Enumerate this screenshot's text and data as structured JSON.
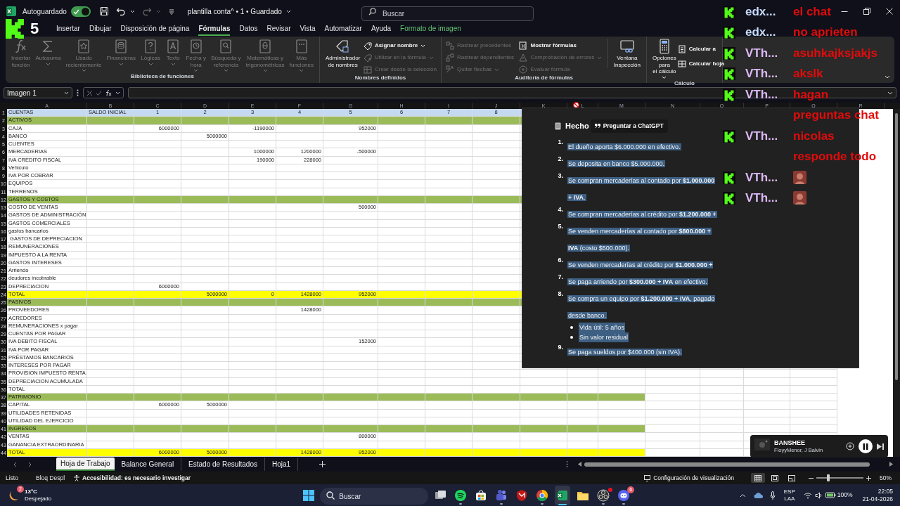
{
  "title_bar": {
    "autosave_label": "Autoguardado",
    "autosave_on": true,
    "document_title": "plantilla conta^ • 1 • Guardado",
    "search_placeholder": "Buscar"
  },
  "stream_overlay": {
    "count": "5"
  },
  "menu_tabs": [
    {
      "label": "Insertar",
      "selected": false,
      "kind": "normal"
    },
    {
      "label": "Dibujar",
      "selected": false,
      "kind": "normal"
    },
    {
      "label": "Disposición de página",
      "selected": false,
      "kind": "normal"
    },
    {
      "label": "Fórmulas",
      "selected": true,
      "kind": "normal"
    },
    {
      "label": "Datos",
      "selected": false,
      "kind": "normal"
    },
    {
      "label": "Revisar",
      "selected": false,
      "kind": "normal"
    },
    {
      "label": "Vista",
      "selected": false,
      "kind": "normal"
    },
    {
      "label": "Automatizar",
      "selected": false,
      "kind": "normal"
    },
    {
      "label": "Ayuda",
      "selected": false,
      "kind": "normal"
    },
    {
      "label": "Formato de imagen",
      "selected": false,
      "kind": "contextual"
    }
  ],
  "ribbon": {
    "groups": [
      {
        "label": "Biblioteca de funciones",
        "items": [
          {
            "kind": "large",
            "label": "Insertar\nfunción",
            "disabled": true
          },
          {
            "kind": "large",
            "label": "Autosuma",
            "disabled": true,
            "dropdown": true
          },
          {
            "kind": "large",
            "label": "Usado\nrecientemente",
            "disabled": true,
            "dropdown": true
          },
          {
            "kind": "large",
            "label": "Financieras",
            "disabled": true,
            "dropdown": true
          },
          {
            "kind": "large",
            "label": "Lógicas",
            "disabled": true,
            "dropdown": true
          },
          {
            "kind": "large",
            "label": "Texto",
            "disabled": true,
            "dropdown": true
          },
          {
            "kind": "large",
            "label": "Fecha y\nhora",
            "disabled": true,
            "dropdown": true
          },
          {
            "kind": "large",
            "label": "Búsqueda y\nreferencia",
            "disabled": true,
            "dropdown": true
          },
          {
            "kind": "large",
            "label": "Matemáticas y\ntrigonométricas",
            "disabled": true,
            "dropdown": true
          },
          {
            "kind": "large",
            "label": "Más\nfunciones",
            "disabled": true,
            "dropdown": true
          }
        ]
      },
      {
        "label": "Nombres definidos",
        "items": [
          {
            "kind": "large",
            "label": "Administrador\nde nombres",
            "disabled": false
          },
          {
            "kind": "stack",
            "items": [
              {
                "label": "Asignar nombre",
                "disabled": false,
                "dropdown": true
              },
              {
                "label": "Utilizar en la fórmula",
                "disabled": true,
                "dropdown": true
              },
              {
                "label": "Crear desde la selección",
                "disabled": true
              }
            ]
          }
        ]
      },
      {
        "label": "Auditoría de fórmulas",
        "items": [
          {
            "kind": "stack",
            "items": [
              {
                "label": "Rastrear precedentes",
                "disabled": true
              },
              {
                "label": "Rastrear dependientes",
                "disabled": true
              },
              {
                "label": "Quitar flechas",
                "disabled": true,
                "dropdown": true
              }
            ]
          },
          {
            "kind": "stack",
            "items": [
              {
                "label": "Mostrar fórmulas",
                "disabled": false
              },
              {
                "label": "Comprobación de errores",
                "disabled": true,
                "dropdown": true
              },
              {
                "label": "Evaluar fórmula",
                "disabled": true
              }
            ]
          },
          {
            "kind": "large",
            "label": "Ventana\nInspección",
            "disabled": false
          }
        ]
      },
      {
        "label": "Cálculo",
        "items": [
          {
            "kind": "large",
            "label": "Opciones para\nel cálculo",
            "disabled": false,
            "dropdown": true
          },
          {
            "kind": "stack",
            "items": [
              {
                "label": "Calcular a",
                "disabled": false
              },
              {
                "label": "Calcular hoja",
                "disabled": false
              }
            ]
          }
        ]
      }
    ]
  },
  "formula_bar": {
    "name_box": "Imagen 1"
  },
  "sheet": {
    "column_letters": [
      "A",
      "B",
      "C",
      "D",
      "E",
      "F",
      "G",
      "H",
      "I",
      "J",
      "K",
      "L",
      "M",
      "N",
      "O",
      "P",
      "Q",
      "R"
    ],
    "rows": [
      {
        "num": "1",
        "kind": "header",
        "cells": {
          "A": "CUENTAS",
          "B": "SALDO INICIAL",
          "C": "1",
          "D": "2",
          "E": "3",
          "F": "4",
          "G": "5",
          "H": "6",
          "I": "7",
          "J": "8"
        }
      },
      {
        "num": "2",
        "kind": "section",
        "cells": {
          "A": "ACTIVOS"
        }
      },
      {
        "num": "3",
        "kind": "data",
        "cells": {
          "A": "CAJA",
          "C": "6000000",
          "E": "-1190000",
          "G": "952000"
        }
      },
      {
        "num": "4",
        "kind": "data",
        "cells": {
          "A": "BANCO",
          "D": "5000000"
        }
      },
      {
        "num": "5",
        "kind": "data",
        "cells": {
          "A": "CLIENTES"
        }
      },
      {
        "num": "6",
        "kind": "data",
        "cells": {
          "A": "MERCADERIAS",
          "E": "1000000",
          "F": "1200000",
          "G": "-500000"
        }
      },
      {
        "num": "7",
        "kind": "data",
        "cells": {
          "A": "IVA CREDITO FISCAL",
          "E": "190000",
          "F": "228000"
        }
      },
      {
        "num": "8",
        "kind": "data",
        "cells": {
          "A": "Vehiculo"
        }
      },
      {
        "num": "9",
        "kind": "data",
        "cells": {
          "A": "IVA POR COBRAR"
        }
      },
      {
        "num": "10",
        "kind": "data",
        "cells": {
          "A": "EQUIPOS"
        }
      },
      {
        "num": "11",
        "kind": "data",
        "cells": {
          "A": "TERRENOS"
        }
      },
      {
        "num": "12",
        "kind": "section",
        "cells": {
          "A": "GASTOS Y COSTOS"
        }
      },
      {
        "num": "13",
        "kind": "data",
        "cells": {
          "A": "COSTO DE VENTAS",
          "G": "500000"
        }
      },
      {
        "num": "14",
        "kind": "data",
        "cells": {
          "A": "GASTOS DE ADMINISTRACIÓN"
        }
      },
      {
        "num": "15",
        "kind": "data",
        "cells": {
          "A": "GASTOS COMERCIALES"
        }
      },
      {
        "num": "16",
        "kind": "data",
        "cells": {
          "A": "gastos bancarios"
        }
      },
      {
        "num": "17",
        "kind": "data",
        "cells": {
          "A": " GASTOS DE DEPRECIACION"
        }
      },
      {
        "num": "18",
        "kind": "data",
        "cells": {
          "A": "REMUNERACIONES"
        }
      },
      {
        "num": "19",
        "kind": "data",
        "cells": {
          "A": "IMPUESTO A LA RENTA"
        }
      },
      {
        "num": "20",
        "kind": "data",
        "cells": {
          "A": "GASTOS INTERESES"
        }
      },
      {
        "num": "21",
        "kind": "data",
        "cells": {
          "A": "Arriendo"
        }
      },
      {
        "num": "22",
        "kind": "data",
        "cells": {
          "A": "deudores incobrable"
        }
      },
      {
        "num": "23",
        "kind": "data",
        "cells": {
          "A": "DEPRECIACION",
          "C": "6000000"
        }
      },
      {
        "num": "24",
        "kind": "total",
        "cells": {
          "A": "TOTAL",
          "D": "5000000",
          "E": "0",
          "F": "1428000",
          "G": "952000"
        }
      },
      {
        "num": "25",
        "kind": "section",
        "cells": {
          "A": "PASIVOS"
        }
      },
      {
        "num": "26",
        "kind": "data",
        "cells": {
          "A": "PROVEEDORES",
          "F": "1428000"
        }
      },
      {
        "num": "27",
        "kind": "data",
        "cells": {
          "A": "ACREDORES"
        }
      },
      {
        "num": "28",
        "kind": "data",
        "cells": {
          "A": "REMUNERACIONES x pagar"
        }
      },
      {
        "num": "29",
        "kind": "data",
        "cells": {
          "A": "CUENTAS POR PAGAR"
        }
      },
      {
        "num": "30",
        "kind": "data",
        "cells": {
          "A": "IVA DEBITO FISCAL",
          "G": "152000"
        }
      },
      {
        "num": "31",
        "kind": "data",
        "cells": {
          "A": "IVA POR PAGAR"
        }
      },
      {
        "num": "32",
        "kind": "data",
        "cells": {
          "A": "PRÉSTAMOS BANCARIOS"
        }
      },
      {
        "num": "33",
        "kind": "data",
        "cells": {
          "A": "INTERESES POR PAGAR"
        }
      },
      {
        "num": "34",
        "kind": "data",
        "cells": {
          "A": "PROVISION IMPUESTO RENTA"
        }
      },
      {
        "num": "35",
        "kind": "data",
        "cells": {
          "A": "DEPRECIACION ACUMULADA"
        }
      },
      {
        "num": "36",
        "kind": "data",
        "cells": {
          "A": "TOTAL"
        }
      },
      {
        "num": "37",
        "kind": "section",
        "cells": {
          "A": "PATRIMONIO"
        }
      },
      {
        "num": "38",
        "kind": "data",
        "cells": {
          "A": "CAPITAL",
          "C": "6000000",
          "D": "5000000"
        }
      },
      {
        "num": "39",
        "kind": "data",
        "cells": {
          "A": "UTILIDADES RETENIDAS"
        }
      },
      {
        "num": "40",
        "kind": "data",
        "cells": {
          "A": "UTILIDAD DEL EJERCICIO"
        }
      },
      {
        "num": "41",
        "kind": "section",
        "cells": {
          "A": "INGRESOS"
        }
      },
      {
        "num": "42",
        "kind": "data",
        "cells": {
          "A": "VENTAS",
          "G": "800000"
        }
      },
      {
        "num": "43",
        "kind": "data",
        "cells": {
          "A": "GANANCIA EXTRAORDINARIA"
        }
      },
      {
        "num": "44",
        "kind": "total",
        "cells": {
          "A": "TOTAL",
          "C": "6000000",
          "D": "5000000",
          "F": "1428000",
          "G": "952000"
        }
      }
    ]
  },
  "answer_panel": {
    "title": "Hecho",
    "ask_button": "Preguntar a ChatGPT",
    "text_selected": true,
    "items": [
      {
        "num": "1.",
        "text": "El dueño aporta $6.000.000 en efectivo."
      },
      {
        "num": "2.",
        "text": "Se deposita en banco $5.000.000."
      },
      {
        "num": "3.",
        "text": "Se compran mercaderías al contado por **$1.000.000 + IVA**."
      },
      {
        "num": "4.",
        "text": "Se compran mercaderías al crédito por **$1.200.000 +**"
      },
      {
        "num": "5.",
        "text": "Se venden mercaderías al contado por **$800.000 + IVA** (costo $500.000)."
      },
      {
        "num": "6.",
        "text": "Se venden mercaderías al crédito por **$1.000.000 +**"
      },
      {
        "num": "7.",
        "text": "Se paga arriendo por **$300.000 + IVA** en efectivo."
      },
      {
        "num": "8.",
        "text": "Se compra un equipo por **$1.200.000 + IVA**, pagado desde banco.",
        "children": [
          {
            "text": "Vida útil: 5 años"
          },
          {
            "text": "Sin valor residual"
          }
        ]
      },
      {
        "num": "9.",
        "text": "Se paga sueldos por $400.000 (sin IVA)."
      }
    ]
  },
  "chat": [
    {
      "kind": "text",
      "user": "edx...",
      "color": "#c9dcff",
      "text": "el chat"
    },
    {
      "kind": "text",
      "user": "edx...",
      "color": "#c9dcff",
      "text": "no aprieten"
    },
    {
      "kind": "text",
      "user": "VTh...",
      "color": "#dcb8f5",
      "text": "asuhkajksjakjs"
    },
    {
      "kind": "text",
      "user": "VTh...",
      "color": "#dcb8f5",
      "text": "akslk"
    },
    {
      "kind": "text",
      "user": "VTh...",
      "color": "#dcb8f5",
      "text": "hagan\npreguntas chat"
    },
    {
      "kind": "text",
      "user": "VTh...",
      "color": "#dcb8f5",
      "text": "nicolas\nresponde todo"
    },
    {
      "kind": "emote",
      "user": "VTh...",
      "color": "#dcb8f5"
    },
    {
      "kind": "emote",
      "user": "VTh...",
      "color": "#dcb8f5"
    }
  ],
  "media": {
    "title": "BANSHEE",
    "artist": "FloyyMenor, J Balvin",
    "playing": true
  },
  "sheet_tabs": [
    {
      "label": "Hoja de Trabajo",
      "selected": true
    },
    {
      "label": "Balance General",
      "selected": false
    },
    {
      "label": "Estado de Resultados",
      "selected": false
    },
    {
      "label": "Hoja1",
      "selected": false
    }
  ],
  "status_bar": {
    "mode": "Listo",
    "scroll_lock": "Bloq Despl",
    "accessibility": "Accesibilidad: es necesario investigar",
    "display_settings": "Configuración de visualización",
    "views": [
      {
        "selected": true
      },
      {
        "selected": false
      },
      {
        "selected": false
      }
    ],
    "zoom": "50%",
    "zoom_slider": {
      "level": 0.25
    }
  },
  "taskbar": {
    "weather": {
      "temp": "13°C",
      "condition": "Despejado",
      "badge": "2"
    },
    "search_placeholder": "Buscar",
    "apps": [
      {
        "selected": false,
        "running": false
      },
      {
        "selected": false,
        "running": true
      },
      {
        "selected": false,
        "running": false
      },
      {
        "selected": false,
        "running": true
      },
      {
        "selected": false,
        "running": false
      },
      {
        "selected": false,
        "running": true
      },
      {
        "selected": true,
        "running": true
      },
      {
        "selected": false,
        "running": false
      },
      {
        "selected": false,
        "running": true,
        "alert": true
      },
      {
        "selected": false,
        "running": true,
        "badge": "6"
      }
    ],
    "language": "ESP",
    "layout": "LAA",
    "battery": "100%",
    "time": "22:05",
    "date": "21-04-2026"
  }
}
